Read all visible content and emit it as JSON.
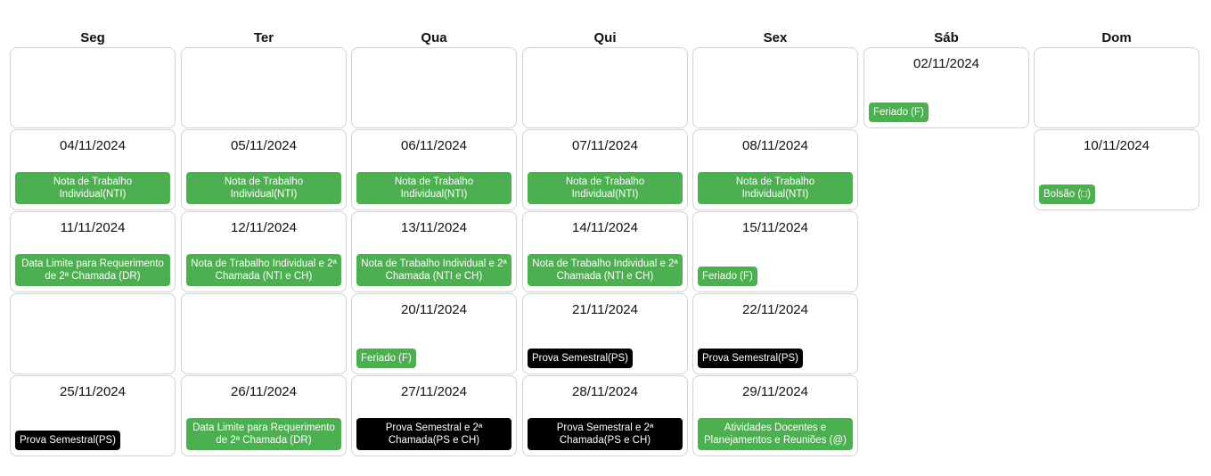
{
  "headers": [
    "Seg",
    "Ter",
    "Qua",
    "Qui",
    "Sex",
    "Sáb",
    "Dom"
  ],
  "colors": {
    "green": "#4caf50",
    "black": "#000000",
    "border": "#d3d3d3"
  },
  "weeks": [
    [
      {
        "date": "",
        "events": []
      },
      {
        "date": "",
        "events": []
      },
      {
        "date": "",
        "events": []
      },
      {
        "date": "",
        "events": []
      },
      {
        "date": "",
        "events": []
      },
      {
        "date": "02/11/2024",
        "events": [
          {
            "label": "Feriado (F)",
            "color": "green",
            "style": "chip"
          }
        ]
      },
      {
        "date": "",
        "events": []
      }
    ],
    [
      {
        "date": "04/11/2024",
        "events": [
          {
            "label": "Nota de Trabalho Individual(NTI)",
            "color": "green",
            "style": "full"
          }
        ]
      },
      {
        "date": "05/11/2024",
        "events": [
          {
            "label": "Nota de Trabalho Individual(NTI)",
            "color": "green",
            "style": "full"
          }
        ]
      },
      {
        "date": "06/11/2024",
        "events": [
          {
            "label": "Nota de Trabalho Individual(NTI)",
            "color": "green",
            "style": "full"
          }
        ]
      },
      {
        "date": "07/11/2024",
        "events": [
          {
            "label": "Nota de Trabalho Individual(NTI)",
            "color": "green",
            "style": "full"
          }
        ]
      },
      {
        "date": "08/11/2024",
        "events": [
          {
            "label": "Nota de Trabalho Individual(NTI)",
            "color": "green",
            "style": "full"
          }
        ]
      },
      null,
      {
        "date": "10/11/2024",
        "events": [
          {
            "label": "Bolsão (□)",
            "color": "green",
            "style": "chip"
          }
        ]
      }
    ],
    [
      {
        "date": "11/11/2024",
        "events": [
          {
            "label": "Data Limite para Requerimento de 2ª Chamada (DR)",
            "color": "green",
            "style": "full"
          }
        ]
      },
      {
        "date": "12/11/2024",
        "events": [
          {
            "label": "Nota de Trabalho Individual e 2ª Chamada (NTI e CH)",
            "color": "green",
            "style": "full"
          }
        ]
      },
      {
        "date": "13/11/2024",
        "events": [
          {
            "label": "Nota de Trabalho Individual e 2ª Chamada (NTI e CH)",
            "color": "green",
            "style": "full"
          }
        ]
      },
      {
        "date": "14/11/2024",
        "events": [
          {
            "label": "Nota de Trabalho Individual e 2ª Chamada (NTI e CH)",
            "color": "green",
            "style": "full"
          }
        ]
      },
      {
        "date": "15/11/2024",
        "events": [
          {
            "label": "Feriado (F)",
            "color": "green",
            "style": "chip"
          }
        ]
      },
      null,
      null
    ],
    [
      {
        "date": "",
        "events": []
      },
      {
        "date": "",
        "events": []
      },
      {
        "date": "20/11/2024",
        "events": [
          {
            "label": "Feriado (F)",
            "color": "green",
            "style": "chip"
          }
        ]
      },
      {
        "date": "21/11/2024",
        "events": [
          {
            "label": "Prova Semestral(PS)",
            "color": "black",
            "style": "chip"
          }
        ]
      },
      {
        "date": "22/11/2024",
        "events": [
          {
            "label": "Prova Semestral(PS)",
            "color": "black",
            "style": "chip"
          }
        ]
      },
      null,
      null
    ],
    [
      {
        "date": "25/11/2024",
        "events": [
          {
            "label": "Prova Semestral(PS)",
            "color": "black",
            "style": "chip"
          }
        ]
      },
      {
        "date": "26/11/2024",
        "events": [
          {
            "label": "Data Limite para Requerimento de 2ª Chamada (DR)",
            "color": "green",
            "style": "full"
          }
        ]
      },
      {
        "date": "27/11/2024",
        "events": [
          {
            "label": "Prova Semestral e 2ª Chamada(PS e CH)",
            "color": "black",
            "style": "full"
          }
        ]
      },
      {
        "date": "28/11/2024",
        "events": [
          {
            "label": "Prova Semestral e 2ª Chamada(PS e CH)",
            "color": "black",
            "style": "full"
          }
        ]
      },
      {
        "date": "29/11/2024",
        "events": [
          {
            "label": "Atividades Docentes e Planejamentos e Reuniões (@)",
            "color": "green",
            "style": "full"
          }
        ]
      },
      null,
      null
    ]
  ]
}
